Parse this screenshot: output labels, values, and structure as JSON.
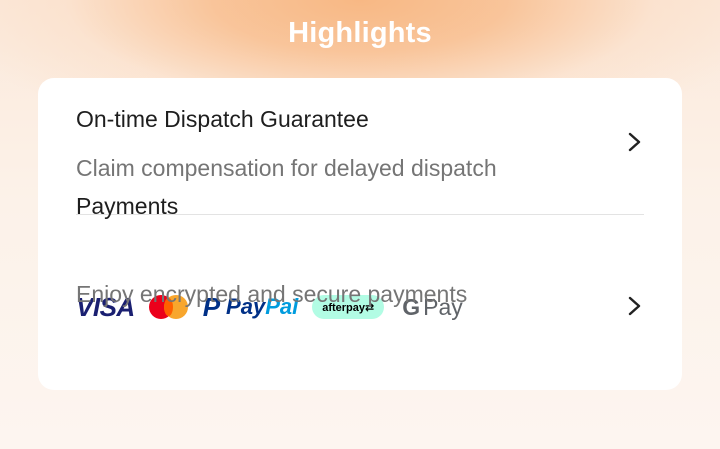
{
  "header": {
    "title": "Highlights"
  },
  "rows": [
    {
      "title": "On-time Dispatch Guarantee",
      "subtitle": "Claim compensation for delayed dispatch"
    },
    {
      "title": "Payments",
      "subtitle": "Enjoy encrypted and secure payments",
      "payment_methods": [
        {
          "name": "VISA",
          "icon": "visa-logo"
        },
        {
          "name": "Mastercard",
          "icon": "mastercard-logo"
        },
        {
          "name": "PayPal",
          "icon": "paypal-logo"
        },
        {
          "name": "afterpay",
          "icon": "afterpay-logo"
        },
        {
          "name": "G Pay",
          "icon": "google-pay-logo"
        }
      ]
    }
  ],
  "colors": {
    "header_gradient": "#f8b884",
    "card_bg": "#ffffff",
    "title_text": "#1e1e1e",
    "subtitle_text": "#757575",
    "visa_blue": "#1a1f71",
    "paypal_dark": "#003087",
    "paypal_light": "#009cde",
    "afterpay_mint": "#b2fce4"
  }
}
